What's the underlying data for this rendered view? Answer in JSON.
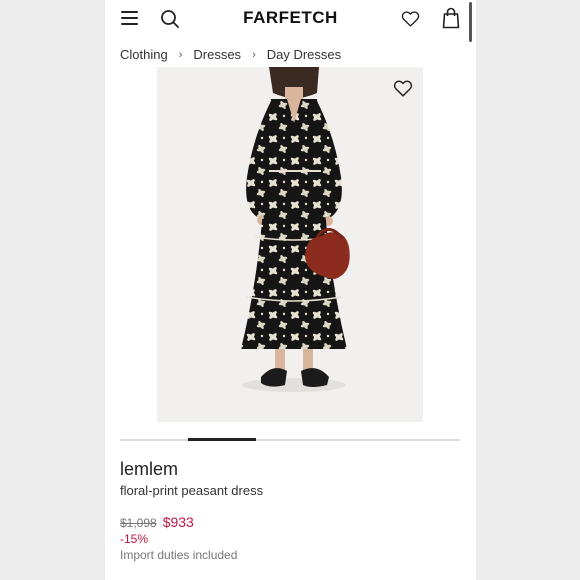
{
  "header": {
    "menu_icon": "hamburger-menu-icon",
    "search_icon": "search-icon",
    "logo": "FARFETCH",
    "wishlist_icon": "heart-icon",
    "bag_icon": "shopping-bag-icon"
  },
  "breadcrumb": {
    "items": [
      "Clothing",
      "Dresses",
      "Day Dresses"
    ],
    "separator": "›"
  },
  "product": {
    "image_icon": "dress-photo",
    "favorite_icon": "heart-icon",
    "brand": "lemlem",
    "name": "floral-print peasant dress",
    "original_price": "$1,098",
    "sale_price": "$933",
    "discount": "-15%",
    "duties_note": "Import duties included"
  },
  "carousel": {
    "active_index": 1,
    "total": 5
  },
  "colors": {
    "accent_sale": "#c0173f",
    "text": "#222222"
  }
}
